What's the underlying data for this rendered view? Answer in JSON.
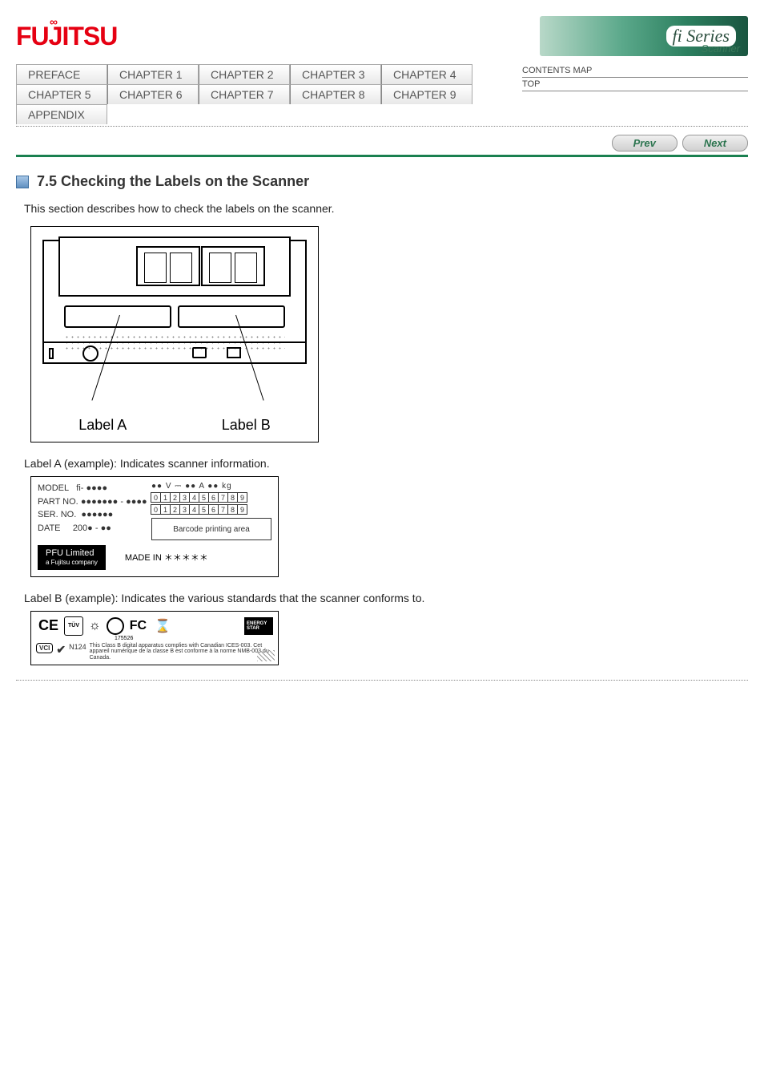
{
  "header": {
    "brand": "FUJITSU",
    "series_badge": "fi Series",
    "series_sub": "Scanner"
  },
  "nav": {
    "tabs_row1": [
      "PREFACE",
      "CHAPTER 1",
      "CHAPTER 2",
      "CHAPTER 3",
      "CHAPTER 4"
    ],
    "tabs_row2": [
      "CHAPTER 5",
      "CHAPTER 6",
      "CHAPTER 7",
      "CHAPTER 8",
      "CHAPTER 9"
    ],
    "tabs_row3": [
      "APPENDIX"
    ],
    "contents": [
      "CONTENTS MAP",
      "TOP"
    ],
    "prev": "Prev",
    "next": "Next"
  },
  "section": {
    "title": "7.5 Checking the Labels on the Scanner",
    "intro": "This section describes how to check the labels on the scanner."
  },
  "figure_main": {
    "label_a": "Label A",
    "label_b": "Label B"
  },
  "label_a": {
    "desc": "Label A (example): Indicates scanner information.",
    "fields": {
      "model_key": "MODEL",
      "model_val": "fi- ●●●●",
      "part_key": "PART NO.",
      "part_val": "●●●●●●● - ●●●●",
      "ser_key": "SER. NO.",
      "ser_val": "●●●●●●",
      "date_key": "DATE",
      "date_val": "200● - ●●",
      "units": "●● V ⎓   ●● A    ●● kg",
      "digits": [
        "0",
        "1",
        "2",
        "3",
        "4",
        "5",
        "6",
        "7",
        "8",
        "9"
      ],
      "barcode": "Barcode printing area",
      "pfu": "PFU Limited",
      "pfu_sub": "a Fujitsu company",
      "madein": "MADE IN  ＊＊＊＊＊"
    }
  },
  "label_b": {
    "desc": "Label B (example): Indicates the various standards that the scanner conforms to.",
    "certs": {
      "ce": "CE",
      "tuv": "TÜV",
      "csa_num": "175526",
      "fc": "FC",
      "estar": "ENERGY STAR",
      "vci": "VCI",
      "ctick": "✔",
      "n124": "N124",
      "compliance": "This Class B digital apparatus complies with Canadian ICES-003. Cet appareil numérique de la classe B est conforme à la norme NMB-003 du Canada."
    }
  }
}
